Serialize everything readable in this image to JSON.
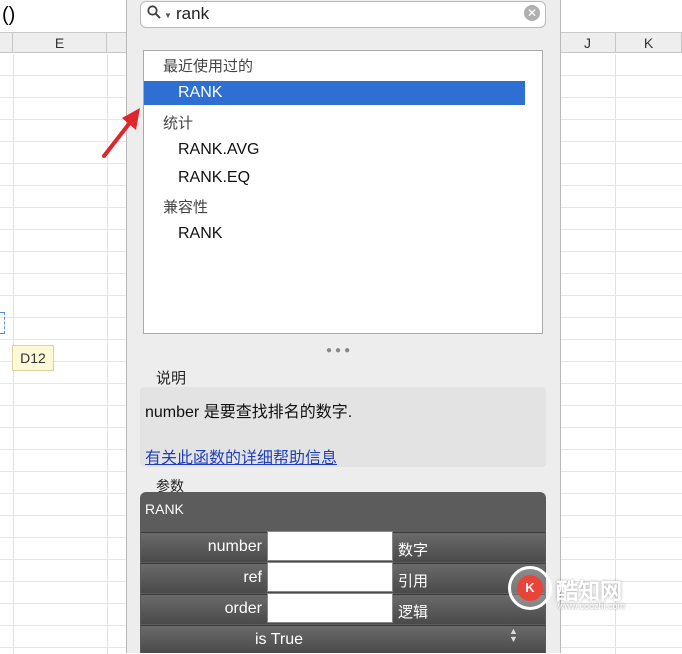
{
  "spreadsheet": {
    "formula_text": "()",
    "columns": [
      "E",
      "J",
      "K"
    ],
    "tooltip_cell": "D12"
  },
  "search": {
    "value": "rank"
  },
  "function_list": {
    "recent_heading": "最近使用过的",
    "recent_items": [
      "RANK"
    ],
    "stats_heading": "统计",
    "stats_items": [
      "RANK.AVG",
      "RANK.EQ"
    ],
    "compat_heading": "兼容性",
    "compat_items": [
      "RANK"
    ],
    "selected": "RANK"
  },
  "description": {
    "label": "说明",
    "text": "number 是要查找排名的数字.",
    "help_link": "有关此函数的详细帮助信息"
  },
  "arguments": {
    "label": "参数",
    "function_name": "RANK",
    "rows": [
      {
        "name": "number",
        "type": "数字"
      },
      {
        "name": "ref",
        "type": "引用"
      },
      {
        "name": "order",
        "type": "逻辑"
      }
    ],
    "extra": "is True"
  },
  "watermark": {
    "name": "酷知网",
    "url": "www.coozhi.com"
  },
  "colors": {
    "selection": "#2d6fd2",
    "arrow": "#e0252b",
    "link": "#1f3fbf"
  }
}
